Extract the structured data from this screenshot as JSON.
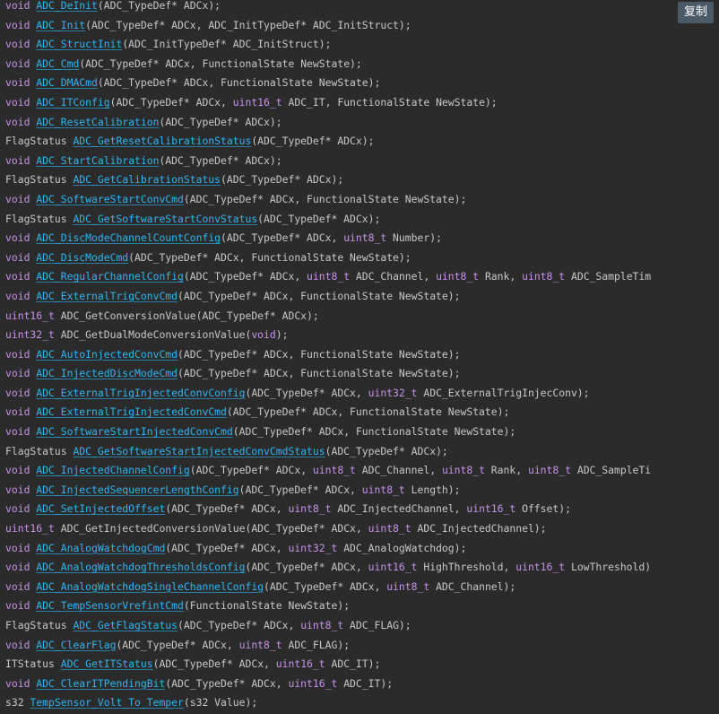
{
  "copy_button": {
    "label": "复制"
  },
  "colors": {
    "background": "#2b2b2b",
    "keyword": "#c792ea",
    "function": "#2fb5f0",
    "text": "#c8c8c8",
    "button_bg": "#4a5a66"
  },
  "code_lines": [
    [
      {
        "t": "kw",
        "v": "void"
      },
      {
        "t": "tx",
        "v": " "
      },
      {
        "t": "fn",
        "v": "ADC_DeInit"
      },
      {
        "t": "tx",
        "v": "(ADC_TypeDef* ADCx);"
      }
    ],
    [
      {
        "t": "kw",
        "v": "void"
      },
      {
        "t": "tx",
        "v": " "
      },
      {
        "t": "fn",
        "v": "ADC_Init"
      },
      {
        "t": "tx",
        "v": "(ADC_TypeDef* ADCx, ADC_InitTypeDef* ADC_InitStruct);"
      }
    ],
    [
      {
        "t": "kw",
        "v": "void"
      },
      {
        "t": "tx",
        "v": " "
      },
      {
        "t": "fn",
        "v": "ADC_StructInit"
      },
      {
        "t": "tx",
        "v": "(ADC_InitTypeDef* ADC_InitStruct);"
      }
    ],
    [
      {
        "t": "kw",
        "v": "void"
      },
      {
        "t": "tx",
        "v": " "
      },
      {
        "t": "fn",
        "v": "ADC_Cmd"
      },
      {
        "t": "tx",
        "v": "(ADC_TypeDef* ADCx, FunctionalState NewState);"
      }
    ],
    [
      {
        "t": "kw",
        "v": "void"
      },
      {
        "t": "tx",
        "v": " "
      },
      {
        "t": "fn",
        "v": "ADC_DMACmd"
      },
      {
        "t": "tx",
        "v": "(ADC_TypeDef* ADCx, FunctionalState NewState);"
      }
    ],
    [
      {
        "t": "kw",
        "v": "void"
      },
      {
        "t": "tx",
        "v": " "
      },
      {
        "t": "fn",
        "v": "ADC_ITConfig"
      },
      {
        "t": "tx",
        "v": "(ADC_TypeDef* ADCx, "
      },
      {
        "t": "kw",
        "v": "uint16_t"
      },
      {
        "t": "tx",
        "v": " ADC_IT, FunctionalState NewState);"
      }
    ],
    [
      {
        "t": "kw",
        "v": "void"
      },
      {
        "t": "tx",
        "v": " "
      },
      {
        "t": "fn",
        "v": "ADC_ResetCalibration"
      },
      {
        "t": "tx",
        "v": "(ADC_TypeDef* ADCx);"
      }
    ],
    [
      {
        "t": "tx",
        "v": "FlagStatus "
      },
      {
        "t": "fn",
        "v": "ADC_GetResetCalibrationStatus"
      },
      {
        "t": "tx",
        "v": "(ADC_TypeDef* ADCx);"
      }
    ],
    [
      {
        "t": "kw",
        "v": "void"
      },
      {
        "t": "tx",
        "v": " "
      },
      {
        "t": "fn",
        "v": "ADC_StartCalibration"
      },
      {
        "t": "tx",
        "v": "(ADC_TypeDef* ADCx);"
      }
    ],
    [
      {
        "t": "tx",
        "v": "FlagStatus "
      },
      {
        "t": "fn",
        "v": "ADC_GetCalibrationStatus"
      },
      {
        "t": "tx",
        "v": "(ADC_TypeDef* ADCx);"
      }
    ],
    [
      {
        "t": "kw",
        "v": "void"
      },
      {
        "t": "tx",
        "v": " "
      },
      {
        "t": "fn",
        "v": "ADC_SoftwareStartConvCmd"
      },
      {
        "t": "tx",
        "v": "(ADC_TypeDef* ADCx, FunctionalState NewState);"
      }
    ],
    [
      {
        "t": "tx",
        "v": "FlagStatus "
      },
      {
        "t": "fn",
        "v": "ADC_GetSoftwareStartConvStatus"
      },
      {
        "t": "tx",
        "v": "(ADC_TypeDef* ADCx);"
      }
    ],
    [
      {
        "t": "kw",
        "v": "void"
      },
      {
        "t": "tx",
        "v": " "
      },
      {
        "t": "fn",
        "v": "ADC_DiscModeChannelCountConfig"
      },
      {
        "t": "tx",
        "v": "(ADC_TypeDef* ADCx, "
      },
      {
        "t": "kw",
        "v": "uint8_t"
      },
      {
        "t": "tx",
        "v": " Number);"
      }
    ],
    [
      {
        "t": "kw",
        "v": "void"
      },
      {
        "t": "tx",
        "v": " "
      },
      {
        "t": "fn",
        "v": "ADC_DiscModeCmd"
      },
      {
        "t": "tx",
        "v": "(ADC_TypeDef* ADCx, FunctionalState NewState);"
      }
    ],
    [
      {
        "t": "kw",
        "v": "void"
      },
      {
        "t": "tx",
        "v": " "
      },
      {
        "t": "fn",
        "v": "ADC_RegularChannelConfig"
      },
      {
        "t": "tx",
        "v": "(ADC_TypeDef* ADCx, "
      },
      {
        "t": "kw",
        "v": "uint8_t"
      },
      {
        "t": "tx",
        "v": " ADC_Channel, "
      },
      {
        "t": "kw",
        "v": "uint8_t"
      },
      {
        "t": "tx",
        "v": " Rank, "
      },
      {
        "t": "kw",
        "v": "uint8_t"
      },
      {
        "t": "tx",
        "v": " ADC_SampleTim"
      }
    ],
    [
      {
        "t": "kw",
        "v": "void"
      },
      {
        "t": "tx",
        "v": " "
      },
      {
        "t": "fn",
        "v": "ADC_ExternalTrigConvCmd"
      },
      {
        "t": "tx",
        "v": "(ADC_TypeDef* ADCx, FunctionalState NewState);"
      }
    ],
    [
      {
        "t": "kw",
        "v": "uint16_t"
      },
      {
        "t": "tx",
        "v": " ADC_GetConversionValue(ADC_TypeDef* ADCx);"
      }
    ],
    [
      {
        "t": "kw",
        "v": "uint32_t"
      },
      {
        "t": "tx",
        "v": " ADC_GetDualModeConversionValue("
      },
      {
        "t": "kw",
        "v": "void"
      },
      {
        "t": "tx",
        "v": ");"
      }
    ],
    [
      {
        "t": "kw",
        "v": "void"
      },
      {
        "t": "tx",
        "v": " "
      },
      {
        "t": "fn",
        "v": "ADC_AutoInjectedConvCmd"
      },
      {
        "t": "tx",
        "v": "(ADC_TypeDef* ADCx, FunctionalState NewState);"
      }
    ],
    [
      {
        "t": "kw",
        "v": "void"
      },
      {
        "t": "tx",
        "v": " "
      },
      {
        "t": "fn",
        "v": "ADC_InjectedDiscModeCmd"
      },
      {
        "t": "tx",
        "v": "(ADC_TypeDef* ADCx, FunctionalState NewState);"
      }
    ],
    [
      {
        "t": "kw",
        "v": "void"
      },
      {
        "t": "tx",
        "v": " "
      },
      {
        "t": "fn",
        "v": "ADC_ExternalTrigInjectedConvConfig"
      },
      {
        "t": "tx",
        "v": "(ADC_TypeDef* ADCx, "
      },
      {
        "t": "kw",
        "v": "uint32_t"
      },
      {
        "t": "tx",
        "v": " ADC_ExternalTrigInjecConv);"
      }
    ],
    [
      {
        "t": "kw",
        "v": "void"
      },
      {
        "t": "tx",
        "v": " "
      },
      {
        "t": "fn",
        "v": "ADC_ExternalTrigInjectedConvCmd"
      },
      {
        "t": "tx",
        "v": "(ADC_TypeDef* ADCx, FunctionalState NewState);"
      }
    ],
    [
      {
        "t": "kw",
        "v": "void"
      },
      {
        "t": "tx",
        "v": " "
      },
      {
        "t": "fn",
        "v": "ADC_SoftwareStartInjectedConvCmd"
      },
      {
        "t": "tx",
        "v": "(ADC_TypeDef* ADCx, FunctionalState NewState);"
      }
    ],
    [
      {
        "t": "tx",
        "v": "FlagStatus "
      },
      {
        "t": "fn",
        "v": "ADC_GetSoftwareStartInjectedConvCmdStatus"
      },
      {
        "t": "tx",
        "v": "(ADC_TypeDef* ADCx);"
      }
    ],
    [
      {
        "t": "kw",
        "v": "void"
      },
      {
        "t": "tx",
        "v": " "
      },
      {
        "t": "fn",
        "v": "ADC_InjectedChannelConfig"
      },
      {
        "t": "tx",
        "v": "(ADC_TypeDef* ADCx, "
      },
      {
        "t": "kw",
        "v": "uint8_t"
      },
      {
        "t": "tx",
        "v": " ADC_Channel, "
      },
      {
        "t": "kw",
        "v": "uint8_t"
      },
      {
        "t": "tx",
        "v": " Rank, "
      },
      {
        "t": "kw",
        "v": "uint8_t"
      },
      {
        "t": "tx",
        "v": " ADC_SampleTi"
      }
    ],
    [
      {
        "t": "kw",
        "v": "void"
      },
      {
        "t": "tx",
        "v": " "
      },
      {
        "t": "fn",
        "v": "ADC_InjectedSequencerLengthConfig"
      },
      {
        "t": "tx",
        "v": "(ADC_TypeDef* ADCx, "
      },
      {
        "t": "kw",
        "v": "uint8_t"
      },
      {
        "t": "tx",
        "v": " Length);"
      }
    ],
    [
      {
        "t": "kw",
        "v": "void"
      },
      {
        "t": "tx",
        "v": " "
      },
      {
        "t": "fn",
        "v": "ADC_SetInjectedOffset"
      },
      {
        "t": "tx",
        "v": "(ADC_TypeDef* ADCx, "
      },
      {
        "t": "kw",
        "v": "uint8_t"
      },
      {
        "t": "tx",
        "v": " ADC_InjectedChannel, "
      },
      {
        "t": "kw",
        "v": "uint16_t"
      },
      {
        "t": "tx",
        "v": " Offset);"
      }
    ],
    [
      {
        "t": "kw",
        "v": "uint16_t"
      },
      {
        "t": "tx",
        "v": " ADC_GetInjectedConversionValue(ADC_TypeDef* ADCx, "
      },
      {
        "t": "kw",
        "v": "uint8_t"
      },
      {
        "t": "tx",
        "v": " ADC_InjectedChannel);"
      }
    ],
    [
      {
        "t": "kw",
        "v": "void"
      },
      {
        "t": "tx",
        "v": " "
      },
      {
        "t": "fn",
        "v": "ADC_AnalogWatchdogCmd"
      },
      {
        "t": "tx",
        "v": "(ADC_TypeDef* ADCx, "
      },
      {
        "t": "kw",
        "v": "uint32_t"
      },
      {
        "t": "tx",
        "v": " ADC_AnalogWatchdog);"
      }
    ],
    [
      {
        "t": "kw",
        "v": "void"
      },
      {
        "t": "tx",
        "v": " "
      },
      {
        "t": "fn",
        "v": "ADC_AnalogWatchdogThresholdsConfig"
      },
      {
        "t": "tx",
        "v": "(ADC_TypeDef* ADCx, "
      },
      {
        "t": "kw",
        "v": "uint16_t"
      },
      {
        "t": "tx",
        "v": " HighThreshold, "
      },
      {
        "t": "kw",
        "v": "uint16_t"
      },
      {
        "t": "tx",
        "v": " LowThreshold)"
      }
    ],
    [
      {
        "t": "kw",
        "v": "void"
      },
      {
        "t": "tx",
        "v": " "
      },
      {
        "t": "fn",
        "v": "ADC_AnalogWatchdogSingleChannelConfig"
      },
      {
        "t": "tx",
        "v": "(ADC_TypeDef* ADCx, "
      },
      {
        "t": "kw",
        "v": "uint8_t"
      },
      {
        "t": "tx",
        "v": " ADC_Channel);"
      }
    ],
    [
      {
        "t": "kw",
        "v": "void"
      },
      {
        "t": "tx",
        "v": " "
      },
      {
        "t": "fn",
        "v": "ADC_TempSensorVrefintCmd"
      },
      {
        "t": "tx",
        "v": "(FunctionalState NewState);"
      }
    ],
    [
      {
        "t": "tx",
        "v": "FlagStatus "
      },
      {
        "t": "fn",
        "v": "ADC_GetFlagStatus"
      },
      {
        "t": "tx",
        "v": "(ADC_TypeDef* ADCx, "
      },
      {
        "t": "kw",
        "v": "uint8_t"
      },
      {
        "t": "tx",
        "v": " ADC_FLAG);"
      }
    ],
    [
      {
        "t": "kw",
        "v": "void"
      },
      {
        "t": "tx",
        "v": " "
      },
      {
        "t": "fn",
        "v": "ADC_ClearFlag"
      },
      {
        "t": "tx",
        "v": "(ADC_TypeDef* ADCx, "
      },
      {
        "t": "kw",
        "v": "uint8_t"
      },
      {
        "t": "tx",
        "v": " ADC_FLAG);"
      }
    ],
    [
      {
        "t": "tx",
        "v": "ITStatus "
      },
      {
        "t": "fn",
        "v": "ADC_GetITStatus"
      },
      {
        "t": "tx",
        "v": "(ADC_TypeDef* ADCx, "
      },
      {
        "t": "kw",
        "v": "uint16_t"
      },
      {
        "t": "tx",
        "v": " ADC_IT);"
      }
    ],
    [
      {
        "t": "kw",
        "v": "void"
      },
      {
        "t": "tx",
        "v": " "
      },
      {
        "t": "fn",
        "v": "ADC_ClearITPendingBit"
      },
      {
        "t": "tx",
        "v": "(ADC_TypeDef* ADCx, "
      },
      {
        "t": "kw",
        "v": "uint16_t"
      },
      {
        "t": "tx",
        "v": " ADC_IT);"
      }
    ],
    [
      {
        "t": "tx",
        "v": "s32 "
      },
      {
        "t": "fn",
        "v": "TempSensor_Volt_To_Temper"
      },
      {
        "t": "tx",
        "v": "(s32 Value);"
      }
    ]
  ]
}
